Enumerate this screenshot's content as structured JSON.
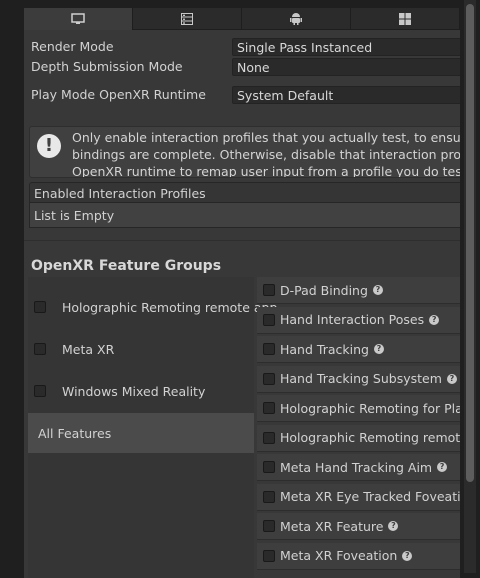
{
  "tabs": [
    {
      "icon": "desktop-icon",
      "active": true
    },
    {
      "icon": "server-icon",
      "active": false
    },
    {
      "icon": "android-icon",
      "active": false
    },
    {
      "icon": "windows-icon",
      "active": false
    }
  ],
  "settings": {
    "render_mode_label": "Render Mode",
    "render_mode_value": "Single Pass Instanced",
    "depth_label": "Depth Submission Mode",
    "depth_value": "None",
    "runtime_label": "Play Mode OpenXR Runtime",
    "runtime_value": "System Default"
  },
  "help": {
    "icon": "warning-icon",
    "line1": "Only enable interaction profiles that you actually test, to ensure their",
    "line2": "bindings are complete. Otherwise, disable that interaction profile, to a",
    "line3": "OpenXR runtime to remap user input from a profile you do test."
  },
  "interaction_profiles": {
    "header": "Enabled Interaction Profiles",
    "empty_text": "List is Empty"
  },
  "feature_groups": {
    "title": "OpenXR Feature Groups",
    "groups": [
      {
        "label": "Holographic Remoting remote app",
        "checked": false
      },
      {
        "label": "Meta XR",
        "checked": false
      },
      {
        "label": "Windows Mixed Reality",
        "checked": false
      }
    ],
    "all_features_label": "All Features"
  },
  "features": [
    {
      "label": "D-Pad Binding",
      "help": true
    },
    {
      "label": "Hand Interaction Poses",
      "help": true
    },
    {
      "label": "Hand Tracking",
      "help": true
    },
    {
      "label": "Hand Tracking Subsystem",
      "help": true
    },
    {
      "label": "Holographic Remoting for Play",
      "help": false
    },
    {
      "label": "Holographic Remoting remote a",
      "help": false
    },
    {
      "label": "Meta Hand Tracking Aim",
      "help": true
    },
    {
      "label": "Meta XR Eye Tracked Foveatio",
      "help": false
    },
    {
      "label": "Meta XR Feature",
      "help": true
    },
    {
      "label": "Meta XR Foveation",
      "help": true
    }
  ],
  "help_glyph": "?"
}
